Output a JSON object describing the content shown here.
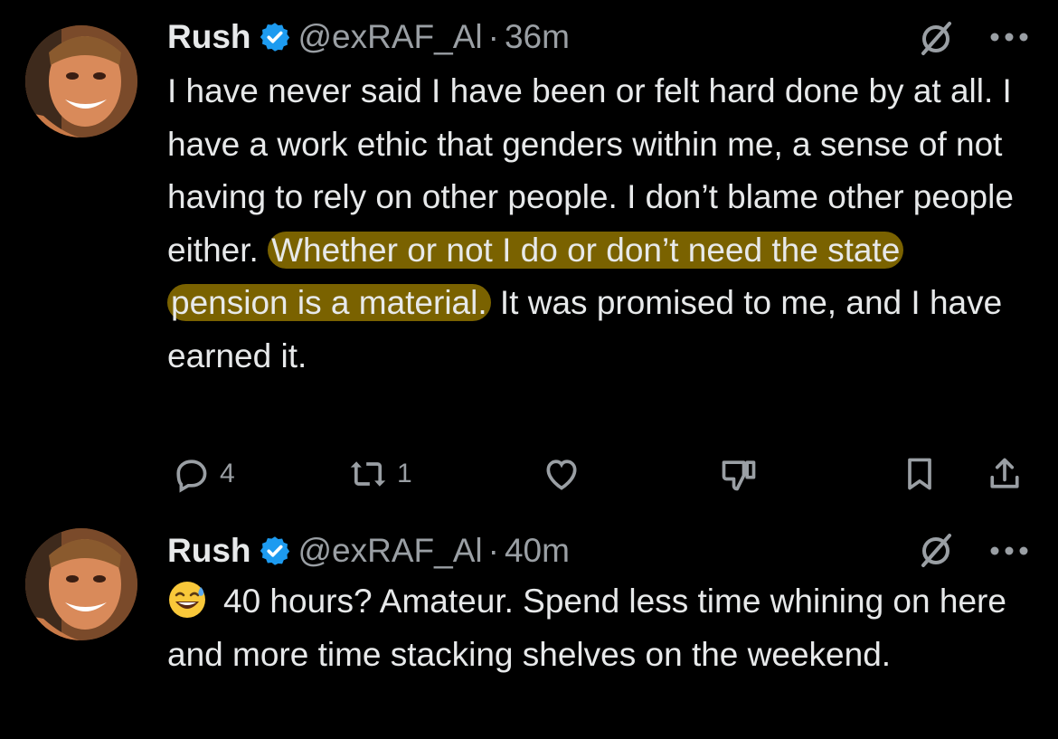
{
  "tweets": [
    {
      "author_name": "Rush",
      "handle": "@exRAF_Al",
      "separator": "·",
      "time": "36m",
      "text_before": "I have never said I have been or felt hard done by at all. I have a work ethic that genders within me, a sense of not having to rely on other people. I don’t blame other people either. ",
      "text_highlight": "Whether or not I do or don’t need the state pension is a material.",
      "text_after": " It was promised to me, and I have earned it.",
      "actions": {
        "reply_count": "4",
        "repost_count": "1",
        "like_count": "",
        "dislike_count": ""
      }
    },
    {
      "author_name": "Rush",
      "handle": "@exRAF_Al",
      "separator": "·",
      "time": "40m",
      "emoji": "sweat-smile-emoji",
      "text": "40 hours?  Amateur.  Spend less time whining on here and more time stacking shelves on the weekend."
    }
  ],
  "colors": {
    "background": "#000000",
    "text": "#e7e9ea",
    "secondary": "#9a9fa4",
    "verified": "#1d9bf0",
    "highlight": "#7a6200"
  }
}
